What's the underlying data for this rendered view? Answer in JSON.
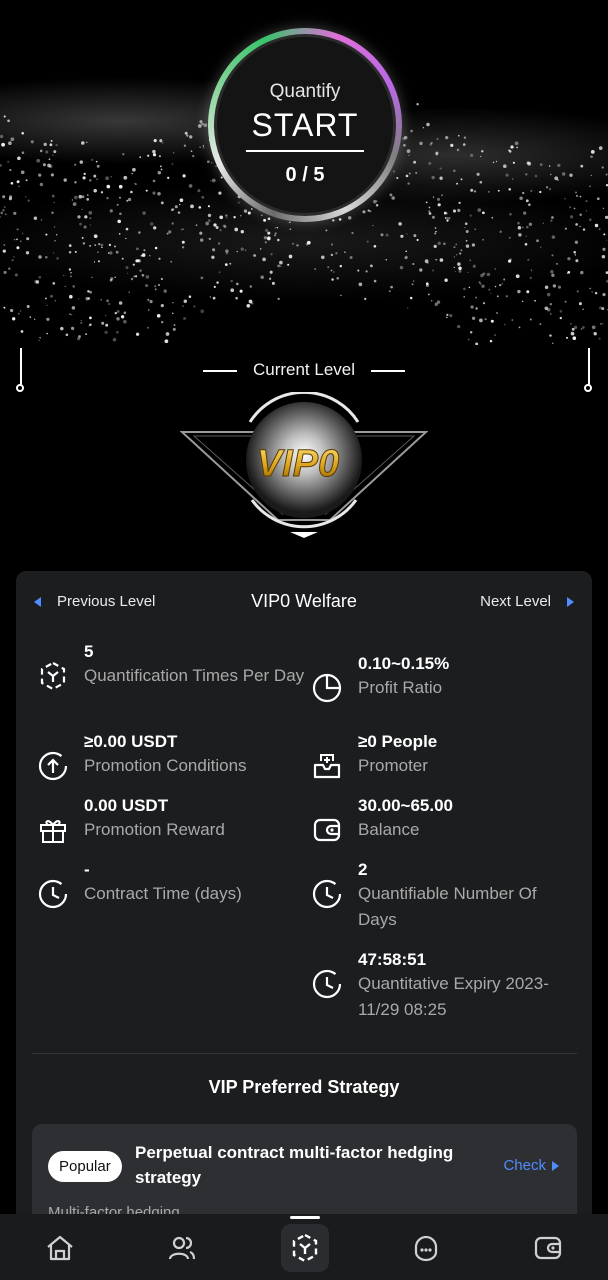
{
  "hero": {
    "quantify_label": "Quantify",
    "start_label": "START",
    "progress_text": "0 / 5"
  },
  "level": {
    "current_label": "Current Level",
    "badge_text": "VIP0"
  },
  "welfare": {
    "prev_label": "Previous Level",
    "title": "VIP0 Welfare",
    "next_label": "Next Level",
    "items": [
      {
        "icon": "quantify-cube-icon",
        "value": "5",
        "label": "Quantification Times Per Day"
      },
      {
        "icon": "pie-chart-icon",
        "value": "0.10~0.15%",
        "label": "Profit Ratio"
      },
      {
        "icon": "upload-circle-icon",
        "value": "≥0.00 USDT",
        "label": "Promotion Conditions"
      },
      {
        "icon": "inbox-plus-icon",
        "value": "≥0 People",
        "label": "Promoter"
      },
      {
        "icon": "gift-icon",
        "value": "0.00 USDT",
        "label": "Promotion Reward"
      },
      {
        "icon": "wallet-icon",
        "value": "30.00~65.00",
        "label": "Balance"
      },
      {
        "icon": "clock-icon",
        "value": "-",
        "label": "Contract Time (days)"
      },
      {
        "icon": "clock-icon",
        "value": "2",
        "label": "Quantifiable Number Of Days"
      },
      {
        "icon": "clock-icon",
        "value": "47:58:51",
        "label": "Quantitative Expiry 2023-11/29 08:25"
      }
    ]
  },
  "strategy": {
    "section_title": "VIP Preferred Strategy",
    "badge": "Popular",
    "name": "Perpetual contract multi-factor hedging strategy",
    "check_label": "Check",
    "description": "Multi-factor hedging"
  },
  "nav": {
    "items": [
      "home-icon",
      "team-icon",
      "quantify-icon",
      "support-icon",
      "wallet-icon"
    ],
    "active": "quantify-icon"
  },
  "colors": {
    "accent": "#4f8cff",
    "card_bg": "#1c1d1f",
    "badge_gold": "#d9a21b"
  }
}
